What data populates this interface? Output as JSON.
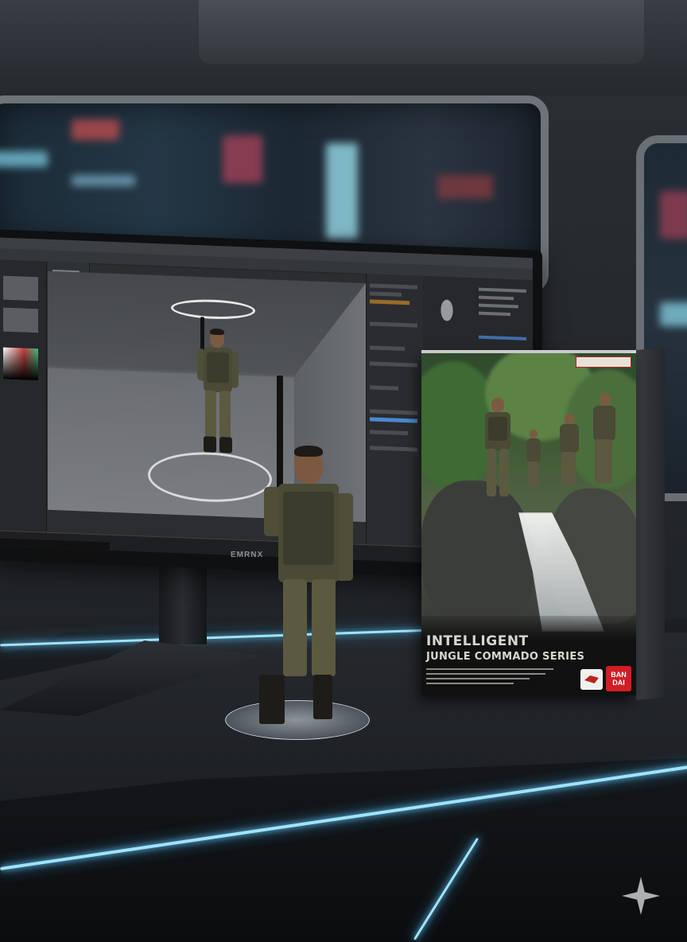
{
  "monitor": {
    "brand_label": "EMRNX"
  },
  "product_box": {
    "title_line1": "INTELLIGENT",
    "title_line2": "JUNGLE COMMADO SERIES",
    "logo_text": "BAN DAI"
  },
  "colors": {
    "neon_accent": "#9fe3ff",
    "logo_red": "#d11e26"
  }
}
